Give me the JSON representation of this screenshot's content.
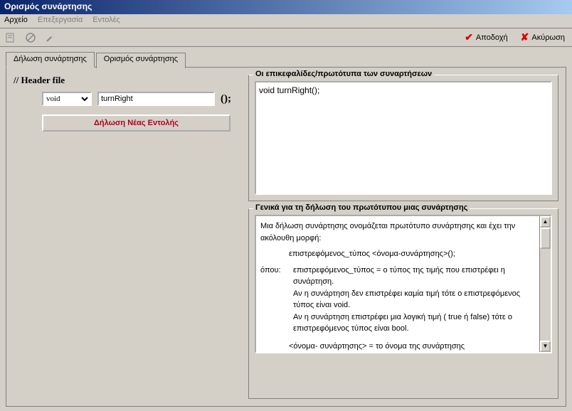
{
  "window": {
    "title": "Ορισμός συνάρτησης"
  },
  "menu": {
    "file": "Αρχείο",
    "edit": "Επεξεργασία",
    "commands": "Εντολές"
  },
  "toolbar": {
    "accept": "Αποδοχή",
    "cancel": "Ακύρωση"
  },
  "tabs": {
    "declaration": "Δήλωση συνάρτησης",
    "definition": "Ορισμός συνάρτησης"
  },
  "left": {
    "header_comment": "// Header file",
    "type_value": "void",
    "name_value": "turnRight",
    "paren": "();",
    "new_cmd_label": "Δήλωση Νέας Εντολής"
  },
  "prototypes": {
    "legend": "Οι επικεφαλίδες/πρωτότυπα των συναρτήσεων",
    "content": "void turnRight();"
  },
  "help": {
    "legend": "Γενικά για τη δήλωση του πρωτότυπου μιας συνάρτησης",
    "p1": "Μια δήλωση συνάρτησης ονομάζεται πρωτότυπο συνάρτησης και έχει την ακόλουθη μορφή:",
    "p2": "επιστρεφόμενος_τύπος <όνομα-συνάρτησης>();",
    "p3_label": "όπου:",
    "p3_a": "επιστρεφόμενος_τύπος = ο τύπος της τιμής που επιστρέφει η συνάρτηση.",
    "p3_b": "Αν η συνάρτηση δεν επιστρέφει καμία τιμή τότε ο επιστρεφόμενος τύπος είναι void.",
    "p3_c": "Αν η συνάρτηση επιστρέφει μια λογική τιμή ( true ή false) τότε ο επιστρεφόμενος τύπος είναι bool.",
    "p4": "<όνομα- συνάρτησης> = το όνομα της συνάρτησης"
  }
}
